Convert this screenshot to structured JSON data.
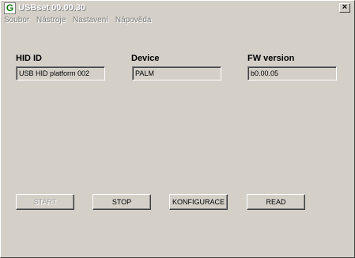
{
  "window": {
    "title": "USBset 00.00.30",
    "close_glyph": "×",
    "app_icon_letter": "G"
  },
  "menu": [
    "Soubor",
    "Nástroje",
    "Nastavení",
    "Nápověda"
  ],
  "fields": {
    "hid": {
      "label": "HID ID",
      "value": "USB HID platform 002"
    },
    "device": {
      "label": "Device",
      "value": "PALM"
    },
    "fw": {
      "label": "FW version",
      "value": "b0.00.05"
    }
  },
  "buttons": {
    "start": "START",
    "stop": "STOP",
    "config": "KONFIGURACE",
    "read": "READ"
  }
}
